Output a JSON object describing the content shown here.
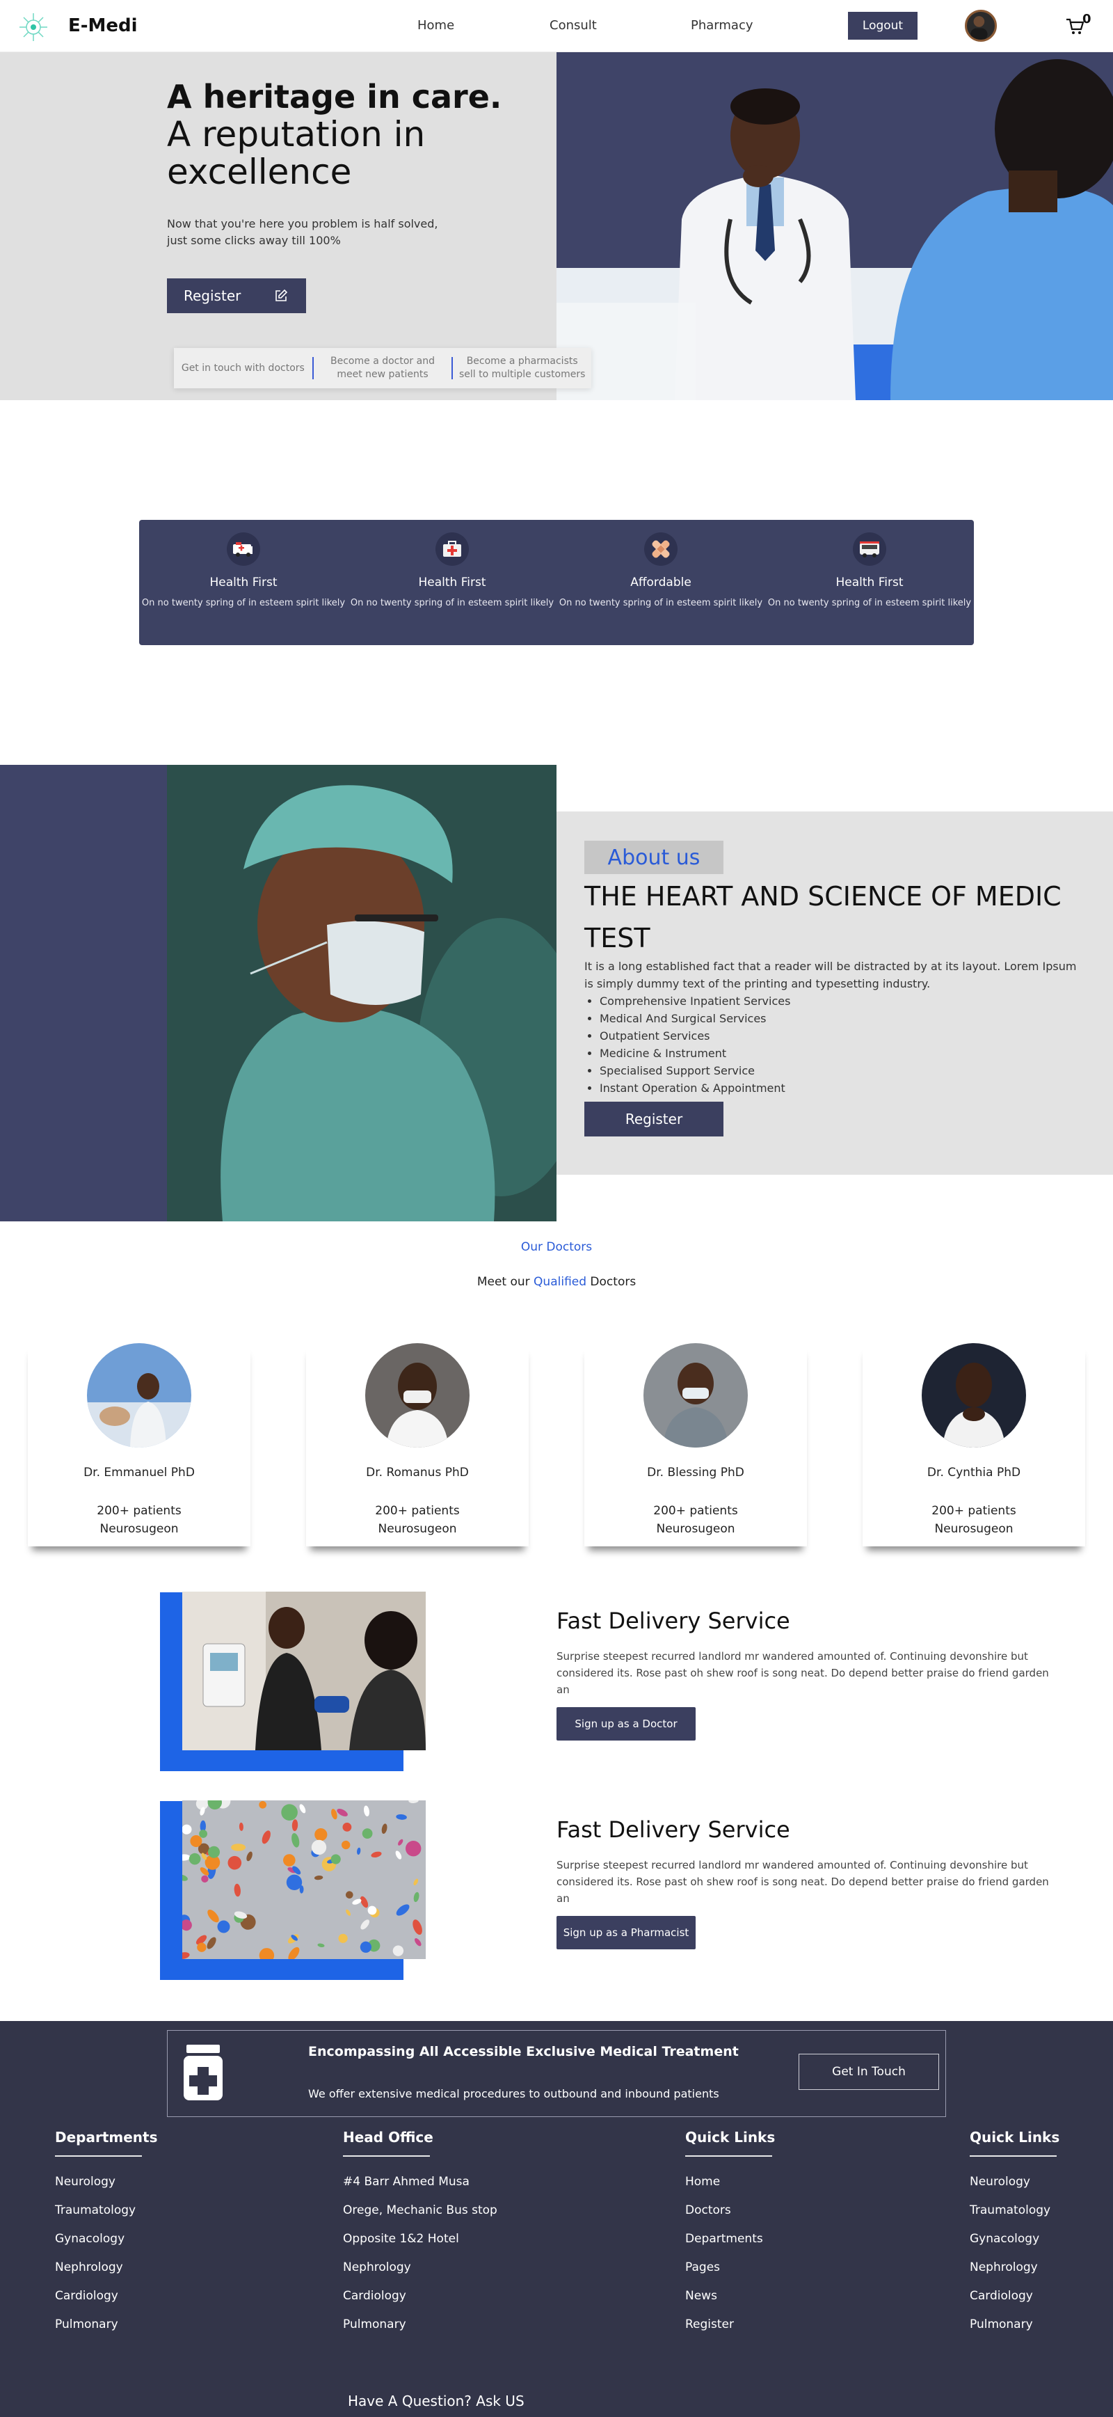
{
  "nav": {
    "brand": "E-Medi",
    "links": [
      "Home",
      "Consult",
      "Pharmacy"
    ],
    "logout": "Logout",
    "cart_count": "0"
  },
  "hero": {
    "title_bold": "A heritage in care.",
    "title_light": "A reputation in excellence",
    "description": "Now that you're here you problem is half solved, just some clicks away till 100%",
    "register": "Register",
    "strip": [
      "Get in touch with doctors",
      "Become a doctor and meet new patients",
      "Become a pharmacists sell to multiple customers"
    ]
  },
  "features": [
    {
      "title": "Health First",
      "desc": "On no twenty spring of in esteem spirit likely",
      "icon": "ambulance-icon"
    },
    {
      "title": "Health First",
      "desc": "On no twenty spring of in esteem spirit likely",
      "icon": "medical-kit-icon"
    },
    {
      "title": "Affordable",
      "desc": "On no twenty spring of in esteem spirit likely",
      "icon": "bandage-icon"
    },
    {
      "title": "Health First",
      "desc": "On no twenty spring of in esteem spirit likely",
      "icon": "hospital-bus-icon"
    }
  ],
  "about": {
    "tag": "About us",
    "heading": "THE HEART AND SCIENCE OF MEDIC TEST",
    "text": "It is a long established fact that a reader will be distracted by at its layout. Lorem Ipsum is simply dummy text of the printing and typesetting industry.",
    "list": [
      "Comprehensive Inpatient Services",
      "Medical And Surgical Services",
      "Outpatient Services",
      "Medicine & Instrument",
      "Specialised Support Service",
      "Instant Operation & Appointment"
    ],
    "register": "Register"
  },
  "doctors": {
    "eyebrow": "Our Doctors",
    "sub_before": "Meet our ",
    "sub_highlight": "Qualified",
    "sub_after": " Doctors",
    "cards": [
      {
        "name": "Dr. Emmanuel PhD",
        "patients": "200+ patients",
        "specialty": "Neurosugeon"
      },
      {
        "name": "Dr. Romanus PhD",
        "patients": "200+ patients",
        "specialty": "Neurosugeon"
      },
      {
        "name": "Dr. Blessing PhD",
        "patients": "200+ patients",
        "specialty": "Neurosugeon"
      },
      {
        "name": "Dr. Cynthia PhD",
        "patients": "200+ patients",
        "specialty": "Neurosugeon"
      }
    ]
  },
  "services": [
    {
      "title": "Fast Delivery Service",
      "text": "Surprise steepest recurred landlord mr wandered amounted of. Continuing devonshire but considered its. Rose past oh shew roof is song neat. Do depend better praise do friend garden an",
      "button": "Sign up as a Doctor"
    },
    {
      "title": "Fast Delivery Service",
      "text": "Surprise steepest recurred landlord mr wandered amounted of. Continuing devonshire but considered its. Rose past oh shew roof is song neat. Do depend better praise do friend garden an",
      "button": "Sign up as a Pharmacist"
    }
  ],
  "footer": {
    "cta_title": "Encompassing All Accessible Exclusive Medical Treatment",
    "cta_text": "We offer extensive medical procedures to outbound and inbound patients",
    "cta_button": "Get In Touch",
    "columns": [
      {
        "title": "Departments",
        "items": [
          "Neurology",
          "Traumatology",
          "Gynacology",
          "Nephrology",
          "Cardiology",
          "Pulmonary"
        ]
      },
      {
        "title": "Head Office",
        "items": [
          "#4 Barr Ahmed Musa",
          "Orege, Mechanic Bus stop",
          "Opposite 1&2 Hotel",
          "Nephrology",
          "Cardiology",
          "Pulmonary"
        ]
      },
      {
        "title": "Quick Links",
        "items": [
          "Home",
          "Doctors",
          "Departments",
          "Pages",
          "News",
          "Register"
        ]
      },
      {
        "title": "Quick Links",
        "items": [
          "Neurology",
          "Traumatology",
          "Gynacology",
          "Nephrology",
          "Cardiology",
          "Pulmonary"
        ]
      }
    ],
    "ask": "Have A Question? Ask US"
  },
  "colors": {
    "navy": "#3b3f5f",
    "accent_blue": "#2a5bd7",
    "footer": "#333549"
  }
}
